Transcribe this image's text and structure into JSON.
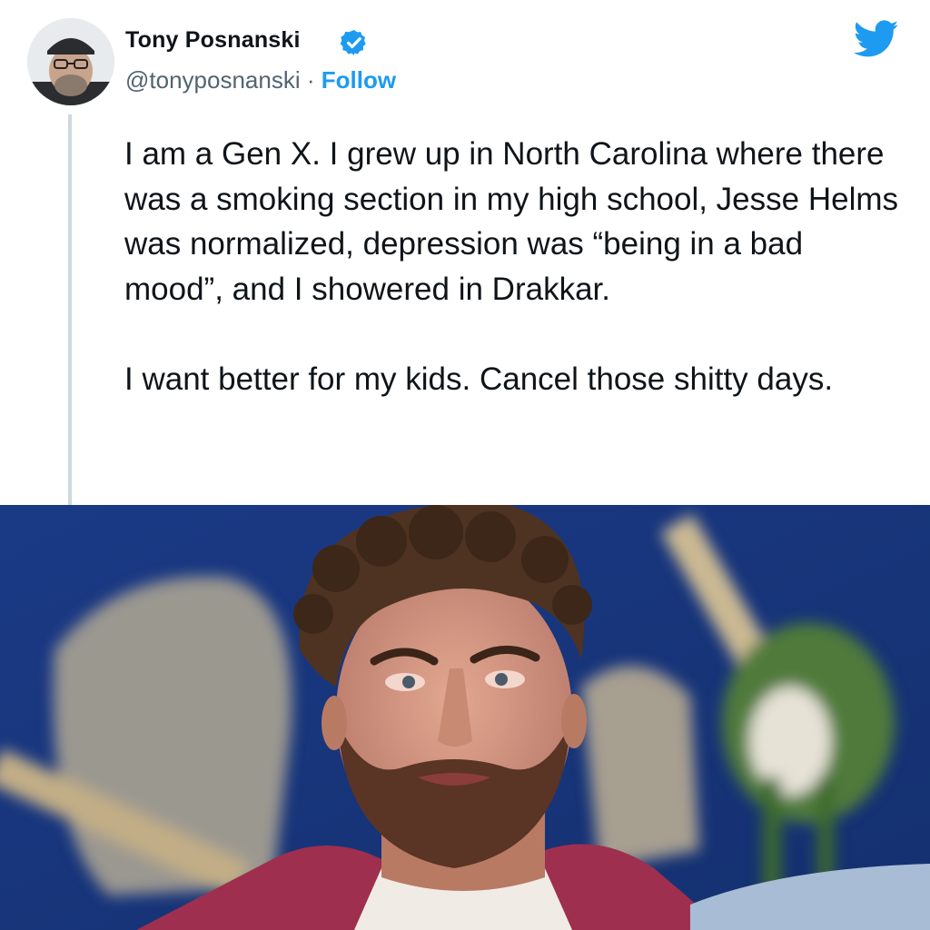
{
  "author": {
    "name": "Tony Posnanski",
    "handle": "@tonyposnanski",
    "separator": " · ",
    "follow_label": "Follow",
    "verified": true
  },
  "tweet": {
    "paragraphs": [
      "I am a Gen X. I grew up in North Carolina where there was a smoking section in my high school, Jesse Helms was normalized, depression was “being in a bad mood”, and I showered in Drakkar.",
      "I want better for my kids. Cancel those shitty days."
    ]
  },
  "icons": {
    "verified": "verified-badge-icon",
    "platform": "twitter-bird-icon"
  },
  "colors": {
    "brand_blue": "#1d9bf0",
    "handle_gray": "#536471",
    "text": "#0f1419"
  }
}
